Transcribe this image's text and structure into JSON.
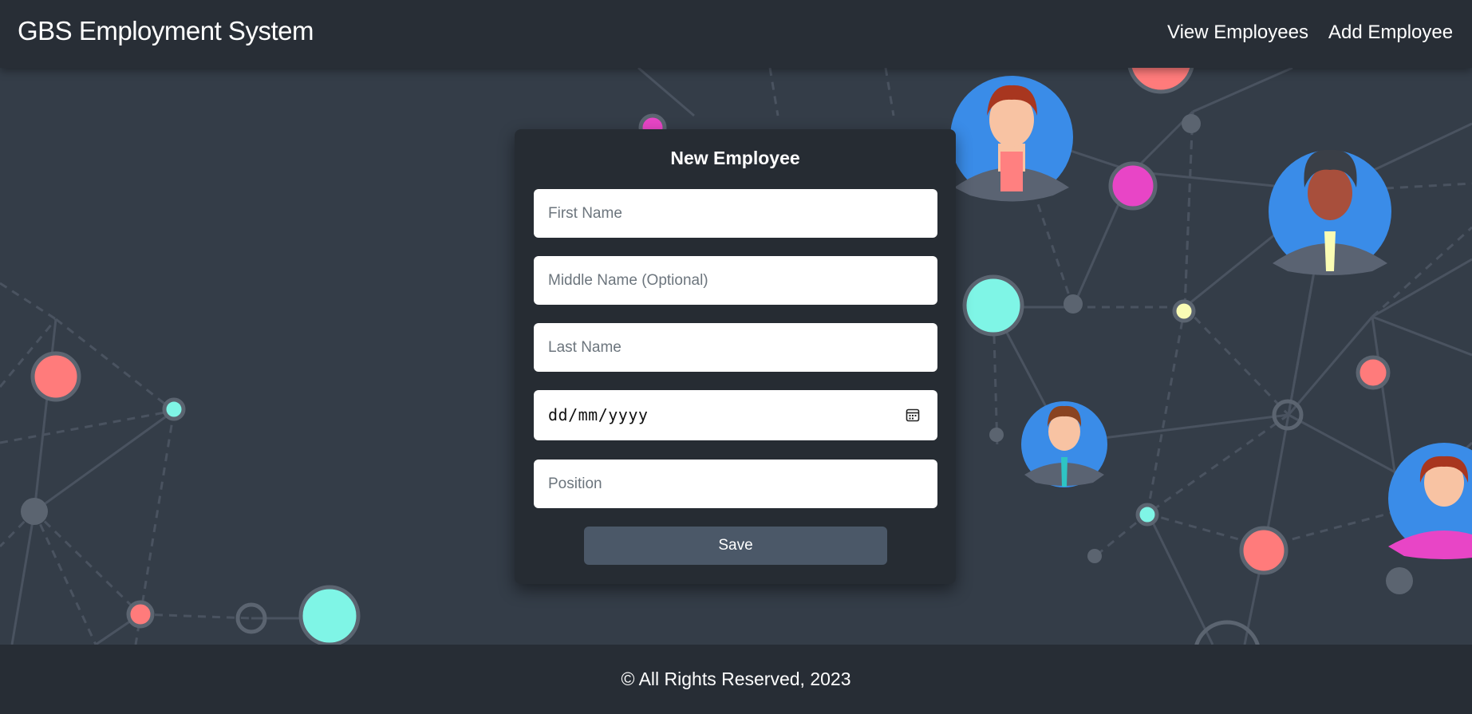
{
  "header": {
    "brand": "GBS Employment System",
    "nav": {
      "view_employees": "View Employees",
      "add_employee": "Add Employee"
    }
  },
  "form": {
    "title": "New Employee",
    "first_name_placeholder": "First Name",
    "middle_name_placeholder": "Middle Name (Optional)",
    "last_name_placeholder": "Last Name",
    "date_placeholder": "dd/mm/yyyy",
    "position_placeholder": "Position",
    "save_label": "Save"
  },
  "footer": {
    "text": "© All Rights Reserved, 2023"
  },
  "colors": {
    "navbar": "#282e36",
    "background": "#343d48",
    "card": "#262c33",
    "button": "#4b5868",
    "node_red": "#ff7b7b",
    "node_cyan": "#7ff5e6",
    "node_magenta": "#e845c6",
    "node_yellow": "#fafcb4",
    "avatar_blue": "#3a8ce8"
  },
  "icons": {
    "date_picker": "calendar-icon"
  }
}
